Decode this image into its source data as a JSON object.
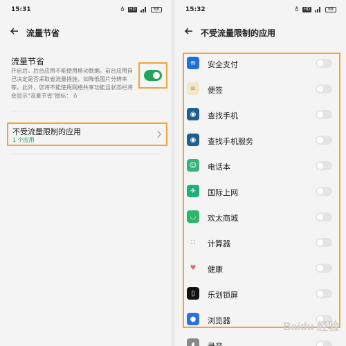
{
  "left": {
    "status": {
      "time": "15:31",
      "battery": "68"
    },
    "header": {
      "title": "流量节省"
    },
    "data_saver": {
      "title": "流量节省",
      "description": "开启后，后台应用不能使用移动数据。前台应用自己决定是否采取省流量措施，如降低图片分辨率等。此外，您将不能使用网络共享功能且状态栏将会显示\"流量节省\"图标：",
      "enabled": true
    },
    "unrestricted": {
      "title": "不受流量限制的应用",
      "subtitle": "1 个应用"
    }
  },
  "right": {
    "status": {
      "time": "15:32",
      "battery": "68"
    },
    "header": {
      "title": "不受流量限制的应用"
    },
    "apps": [
      {
        "name": "安全支付",
        "icon": "shield-app-icon",
        "color": "#1e6fd9",
        "enabled": false
      },
      {
        "name": "便签",
        "icon": "notes-app-icon",
        "color": "#f5e6c4",
        "enabled": false
      },
      {
        "name": "查找手机",
        "icon": "find-phone-app-icon",
        "color": "#1f5f8f",
        "enabled": false
      },
      {
        "name": "查找手机服务",
        "icon": "find-phone-service-app-icon",
        "color": "#1f5f8f",
        "enabled": false
      },
      {
        "name": "电话本",
        "icon": "contacts-app-icon",
        "color": "#34b37c",
        "enabled": false
      },
      {
        "name": "国际上网",
        "icon": "airplane-app-icon",
        "color": "#1fb07a",
        "enabled": false
      },
      {
        "name": "欢太商城",
        "icon": "store-app-icon",
        "color": "#2fb56a",
        "enabled": false
      },
      {
        "name": "计算器",
        "icon": "calculator-app-icon",
        "color": "#f4f4f4",
        "enabled": false
      },
      {
        "name": "健康",
        "icon": "health-app-icon",
        "color": "#f4f4f4",
        "enabled": false
      },
      {
        "name": "乐划锁屏",
        "icon": "lockscreen-app-icon",
        "color": "#111111",
        "enabled": false
      },
      {
        "name": "浏览器",
        "icon": "browser-app-icon",
        "color": "#2a6ee8",
        "enabled": false
      },
      {
        "name": "录音",
        "icon": "recorder-app-icon",
        "color": "#888888",
        "enabled": false
      }
    ]
  },
  "watermark": "Baidu 经验"
}
